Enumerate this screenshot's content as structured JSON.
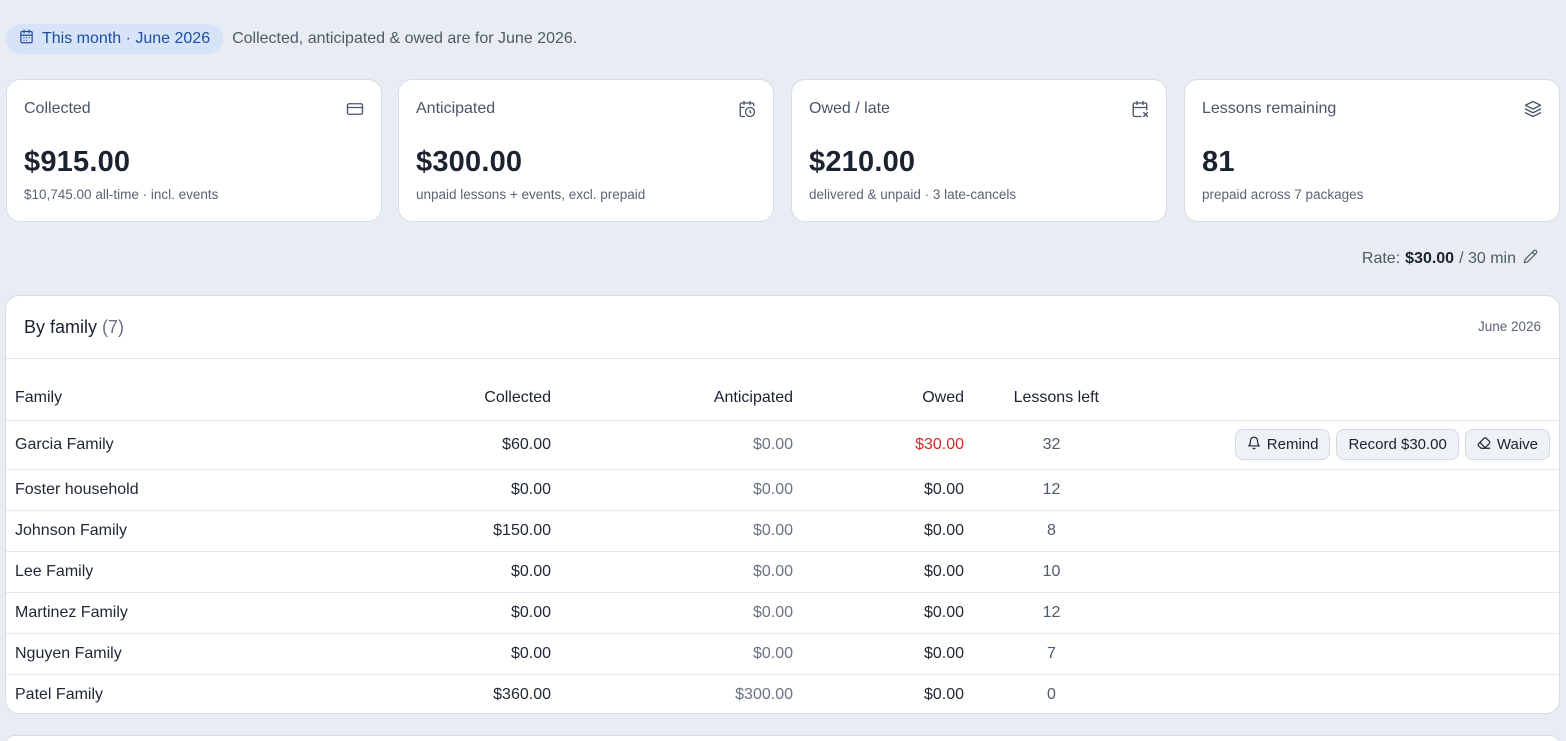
{
  "period": {
    "chip_label": "This month · June 2026",
    "note": "Collected, anticipated & owed are for June 2026.",
    "icon": "calendar-icon"
  },
  "cards": [
    {
      "label": "Collected",
      "icon": "credit-card-icon",
      "value": "$915.00",
      "sub": "$10,745.00 all-time · incl. events"
    },
    {
      "label": "Anticipated",
      "icon": "calendar-clock-icon",
      "value": "$300.00",
      "sub": "unpaid lessons + events, excl. prepaid"
    },
    {
      "label": "Owed / late",
      "icon": "calendar-x-icon",
      "value": "$210.00",
      "sub": "delivered & unpaid · 3 late-cancels"
    },
    {
      "label": "Lessons remaining",
      "icon": "layers-icon",
      "value": "81",
      "sub": "prepaid across 7 packages"
    }
  ],
  "rate": {
    "prefix": "Rate:",
    "amount": "$30.00",
    "unit": "/ 30 min",
    "edit_icon": "pencil-icon"
  },
  "family_table": {
    "title": "By family",
    "count": "(7)",
    "period": "June 2026",
    "columns": [
      "Family",
      "Collected",
      "Anticipated",
      "Owed",
      "Lessons left"
    ],
    "rows": [
      {
        "family": "Garcia Family",
        "collected": "$60.00",
        "anticipated": "$0.00",
        "owed": "$30.00",
        "lessons": "32",
        "owed_late": true
      },
      {
        "family": "Foster household",
        "collected": "$0.00",
        "anticipated": "$0.00",
        "owed": "$0.00",
        "lessons": "12"
      },
      {
        "family": "Johnson Family",
        "collected": "$150.00",
        "anticipated": "$0.00",
        "owed": "$0.00",
        "lessons": "8"
      },
      {
        "family": "Lee Family",
        "collected": "$0.00",
        "anticipated": "$0.00",
        "owed": "$0.00",
        "lessons": "10"
      },
      {
        "family": "Martinez Family",
        "collected": "$0.00",
        "anticipated": "$0.00",
        "owed": "$0.00",
        "lessons": "12"
      },
      {
        "family": "Nguyen Family",
        "collected": "$0.00",
        "anticipated": "$0.00",
        "owed": "$0.00",
        "lessons": "7"
      },
      {
        "family": "Patel Family",
        "collected": "$360.00",
        "anticipated": "$300.00",
        "owed": "$0.00",
        "lessons": "0"
      }
    ],
    "actions": {
      "remind": "Remind",
      "record": "Record $30.00",
      "waive": "Waive",
      "remind_icon": "bell-icon",
      "waive_icon": "eraser-icon"
    }
  },
  "colors": {
    "accent": "#1e4fa3",
    "chip_bg": "#d7e3f8",
    "owed_red": "#d02b2b",
    "page_bg": "#e8ecf3"
  }
}
